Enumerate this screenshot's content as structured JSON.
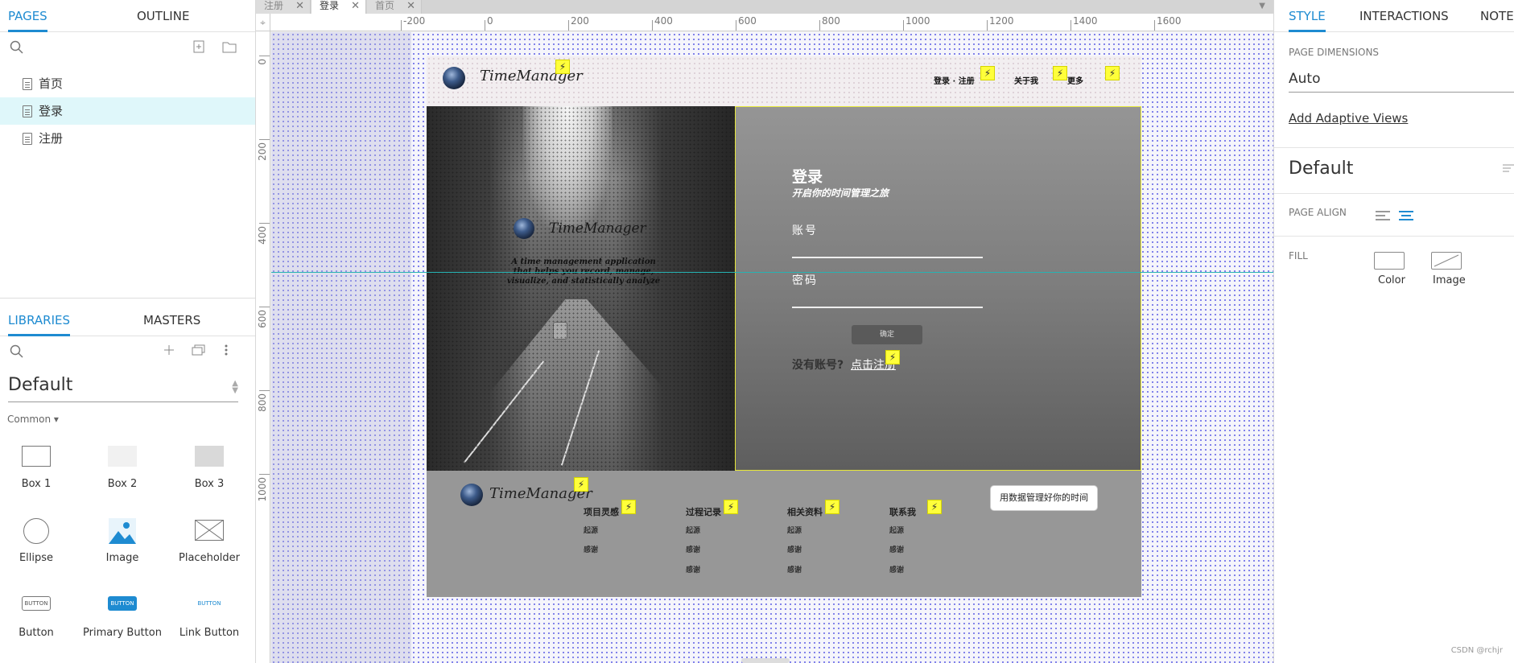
{
  "left_panel": {
    "tabs": {
      "pages": "PAGES",
      "outline": "OUTLINE"
    },
    "pages": [
      {
        "label": "首页",
        "selected": false
      },
      {
        "label": "登录",
        "selected": true
      },
      {
        "label": "注册",
        "selected": false
      }
    ],
    "library_tabs": {
      "libraries": "LIBRARIES",
      "masters": "MASTERS"
    },
    "library_name": "Default",
    "category": "Common ▾",
    "widgets": [
      {
        "label": "Box 1",
        "icon": "box1-icon"
      },
      {
        "label": "Box 2",
        "icon": "box2-icon"
      },
      {
        "label": "Box 3",
        "icon": "box3-icon"
      },
      {
        "label": "Ellipse",
        "icon": "ellipse-icon"
      },
      {
        "label": "Image",
        "icon": "image-icon"
      },
      {
        "label": "Placeholder",
        "icon": "placeholder-icon"
      },
      {
        "label": "Button",
        "icon": "button-icon"
      },
      {
        "label": "Primary Button",
        "icon": "primary-button-icon"
      },
      {
        "label": "Link Button",
        "icon": "link-button-icon"
      }
    ],
    "widget_icon_text": "BUTTON"
  },
  "doc_tabs": [
    {
      "label": "注册",
      "active": false
    },
    {
      "label": "登录",
      "active": true
    },
    {
      "label": "首页",
      "active": false
    }
  ],
  "rulers": {
    "h_labels": [
      "-200",
      "0",
      "200",
      "400",
      "600",
      "800",
      "1000",
      "1200",
      "1400",
      "1600"
    ],
    "v_labels": [
      "0",
      "200",
      "400",
      "600",
      "800",
      "1000"
    ]
  },
  "page": {
    "brand": "TimeManager",
    "nav": {
      "login_register": "登录 · 注册",
      "about": "关于我",
      "more": "更多"
    },
    "tagline": "A time management application that helps you record, manage, visualize, and statistically analyze",
    "login": {
      "title": "登录",
      "subtitle": "开启你的时间管理之旅",
      "account_label": "账号",
      "password_label": "密码",
      "ok_button": "确定",
      "no_account": "没有账号?",
      "register_link": "点击注册"
    },
    "footer": {
      "columns": [
        {
          "title": "项目灵感",
          "items": [
            "起源",
            "感谢"
          ]
        },
        {
          "title": "过程记录",
          "items": [
            "起源",
            "感谢",
            "感谢"
          ]
        },
        {
          "title": "相关资料",
          "items": [
            "起源",
            "感谢",
            "感谢"
          ]
        },
        {
          "title": "联系我",
          "items": [
            "起源",
            "感谢",
            "感谢"
          ]
        }
      ],
      "slogan_button": "用数据管理好你的时间"
    },
    "bolt_glyph": "⚡"
  },
  "right_panel": {
    "tabs": {
      "style": "STYLE",
      "interactions": "INTERACTIONS",
      "notes": "NOTES"
    },
    "page_dimensions_label": "PAGE DIMENSIONS",
    "page_dimensions_value": "Auto",
    "adaptive_link": "Add Adaptive Views",
    "style_name": "Default",
    "page_align_label": "PAGE ALIGN",
    "fill_label": "FILL",
    "fill_color": "Color",
    "fill_image": "Image"
  },
  "watermark": "CSDN @rchjr",
  "colors": {
    "accent": "#1e8bd1",
    "selected_row": "#dff7fa",
    "guide": "#27b3b3",
    "note_bolt": "#ffff3a"
  }
}
